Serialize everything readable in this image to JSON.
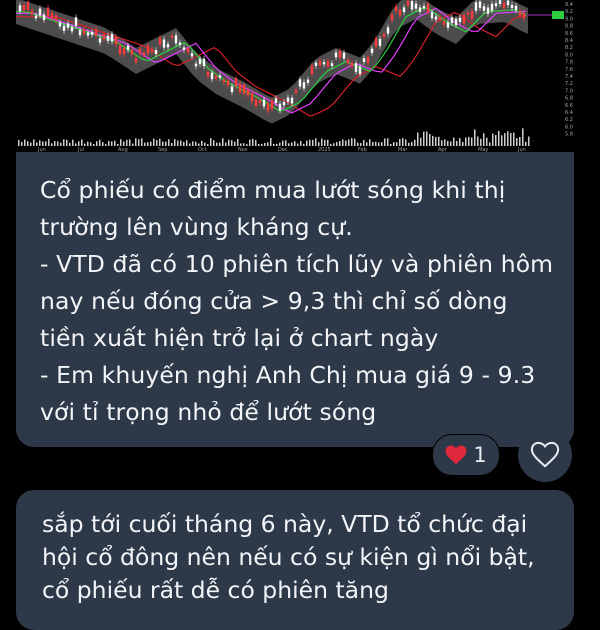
{
  "chart": {
    "x_labels": [
      "Jun",
      "Jul",
      "Aug",
      "Sep",
      "Oct",
      "Nov",
      "Dec",
      "2025",
      "Feb",
      "Mar",
      "Apr",
      "May",
      "Jun"
    ],
    "y_labels": [
      "9.4",
      "9.2",
      "9.0",
      "8.8",
      "8.6",
      "8.4",
      "8.2",
      "8.0",
      "7.8",
      "7.6",
      "7.4",
      "7.2",
      "7.0",
      "6.8",
      "6.6",
      "6.4",
      "6.2",
      "6.0",
      "5.8"
    ],
    "colors": {
      "up": "#ff3b3b",
      "down": "#ffffff",
      "band": "#8a8a8a",
      "ma_green": "#2ecc40",
      "ma_magenta": "#e040fb",
      "ma_red": "#d0202a",
      "ma_yellow": "#e6d400"
    }
  },
  "message1": {
    "text": "Cổ phiếu có điểm mua lướt sóng khi thị trường lên vùng kháng cự.\n- VTD đã có 10 phiên tích lũy và phiên hôm nay nếu đóng cửa > 9,3 thì chỉ số dòng tiền xuất hiện trở lại ở chart ngày\n- Em khuyến nghị Anh Chị mua giá 9 - 9.3 với tỉ trọng nhỏ để lướt sóng"
  },
  "reaction": {
    "emoji": "heart-icon",
    "count": "1",
    "color": "#e0283c"
  },
  "message2": {
    "text": "sắp tới cuối tháng 6 này, VTD tổ chức đại hội cổ đông nên nếu có sự kiện gì nổi bật, cổ phiếu rất dễ có phiên tăng"
  },
  "theme": {
    "bubble": "#2d3948",
    "background": "#000000",
    "text": "#f2f4f7"
  }
}
